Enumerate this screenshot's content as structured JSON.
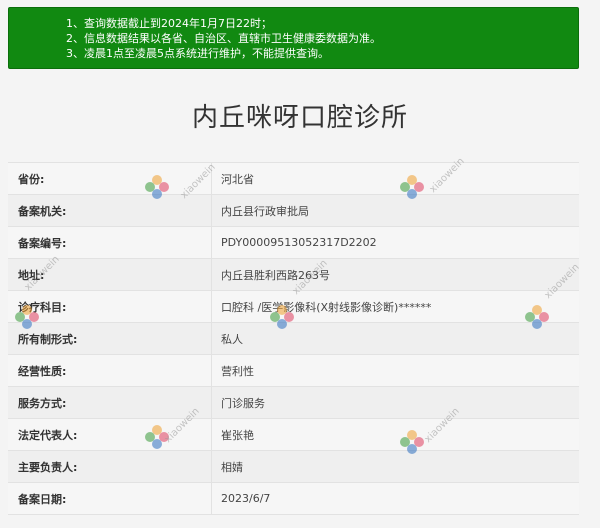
{
  "notice": {
    "lines": [
      {
        "num": "1、",
        "text": "查询数据截止到2024年1月7日22时；"
      },
      {
        "num": "2、",
        "text": "信息数据结果以各省、自治区、直辖市卫生健康委数据为准。"
      },
      {
        "num": "3、",
        "text": "凌晨1点至凌晨5点系统进行维护，不能提供查询。"
      }
    ]
  },
  "page_title": "内丘咪呀口腔诊所",
  "rows": [
    {
      "label": "省份:",
      "value": "河北省"
    },
    {
      "label": "备案机关:",
      "value": "内丘县行政审批局"
    },
    {
      "label": "备案编号:",
      "value": "PDY00009513052317D2202"
    },
    {
      "label": "地址:",
      "value": "内丘县胜利西路263号"
    },
    {
      "label": "诊疗科目:",
      "value": "口腔科 /医学影像科(X射线影像诊断)******"
    },
    {
      "label": "所有制形式:",
      "value": "私人"
    },
    {
      "label": "经营性质:",
      "value": "营利性"
    },
    {
      "label": "服务方式:",
      "value": "门诊服务"
    },
    {
      "label": "法定代表人:",
      "value": "崔张艳"
    },
    {
      "label": "主要负责人:",
      "value": "相婧"
    },
    {
      "label": "备案日期:",
      "value": "2023/6/7"
    }
  ],
  "watermark": {
    "text": "xiaowein",
    "logo": "flower-logo-icon"
  },
  "colors": {
    "notice_bg": "#118911",
    "notice_text": "#ffffff"
  }
}
